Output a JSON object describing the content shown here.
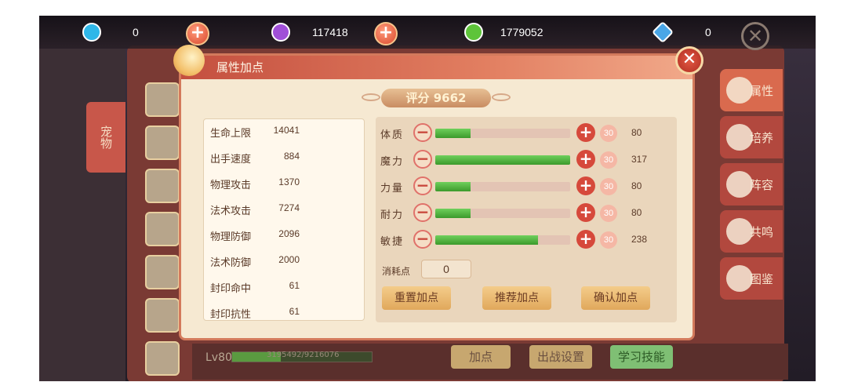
{
  "currencies": [
    {
      "icon": "blue-gem-icon",
      "color": "#2fb7e8",
      "value": "0"
    },
    {
      "icon": "purple-gem-icon",
      "color": "#a04fd8",
      "value": "117418"
    },
    {
      "icon": "green-gem-icon",
      "color": "#5ec43a",
      "value": "1779052"
    },
    {
      "icon": "diamond-icon",
      "color": "#4aa6e6",
      "value": "0"
    }
  ],
  "bg": {
    "left_tab": "宠物",
    "right_tabs": [
      "属性",
      "培养",
      "阵容",
      "共鸣",
      "图鉴"
    ],
    "level": "Lv80",
    "exp_text": "3195492/9216076",
    "exp_fraction": 0.347,
    "bottom_buttons": [
      "加点",
      "出战设置",
      "学习技能"
    ]
  },
  "dialog": {
    "title": "属性加点",
    "score_label": "评分",
    "score_value": "9662",
    "stats": [
      {
        "label": "生命上限",
        "value": "14041"
      },
      {
        "label": "出手速度",
        "value": "884"
      },
      {
        "label": "物理攻击",
        "value": "1370"
      },
      {
        "label": "法术攻击",
        "value": "7274"
      },
      {
        "label": "物理防御",
        "value": "2096"
      },
      {
        "label": "法术防御",
        "value": "2000"
      },
      {
        "label": "封印命中",
        "value": "61"
      },
      {
        "label": "封印抗性",
        "value": "61"
      }
    ],
    "attributes": [
      {
        "label": "体质",
        "points": "30",
        "value": "80",
        "fill": 0.26
      },
      {
        "label": "魔力",
        "points": "30",
        "value": "317",
        "fill": 1.0
      },
      {
        "label": "力量",
        "points": "30",
        "value": "80",
        "fill": 0.26
      },
      {
        "label": "耐力",
        "points": "30",
        "value": "80",
        "fill": 0.26
      },
      {
        "label": "敏捷",
        "points": "30",
        "value": "238",
        "fill": 0.76
      }
    ],
    "cost_label": "消耗点",
    "cost_value": "0",
    "buttons": {
      "reset": "重置加点",
      "recommend": "推荐加点",
      "confirm": "确认加点"
    }
  }
}
